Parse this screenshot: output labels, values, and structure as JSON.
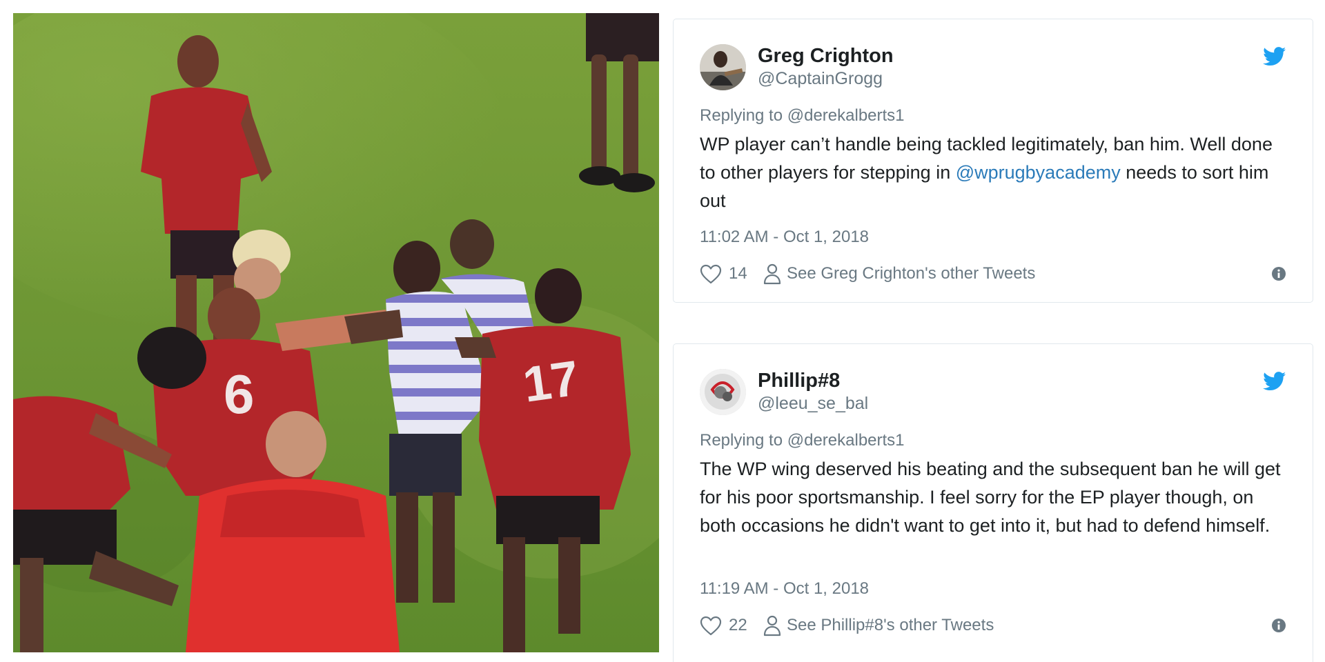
{
  "tweets": [
    {
      "name": "Greg Crighton",
      "handle": "@CaptainGrogg",
      "replying_prefix": "Replying to ",
      "replying_to": "@derekalberts1",
      "text_part1": "WP player can’t handle being tackled legitimately, ban him. Well done to other players for stepping in ",
      "mention": "@wprugbyacademy",
      "text_part2": " needs to sort him out",
      "timestamp": "11:02 AM - Oct 1, 2018",
      "likes": "14",
      "other_tweets_label": "See Greg Crighton's other Tweets"
    },
    {
      "name": "Phillip#8",
      "handle": "@leeu_se_bal",
      "replying_prefix": "Replying to ",
      "replying_to": "@derekalberts1",
      "text": "The WP wing deserved his beating and the subsequent ban he will get for his poor sportsmanship. I feel sorry for the EP player though, on both occasions he didn't want to get into it, but had to defend himself.",
      "timestamp": "11:19 AM - Oct 1, 2018",
      "likes": "22",
      "other_tweets_label": "See Phillip#8's other Tweets"
    }
  ],
  "icons": {
    "twitter": "twitter-bird-icon",
    "like": "heart-icon",
    "profile": "person-icon",
    "info": "info-icon"
  },
  "colors": {
    "twitter_blue": "#1da1f2",
    "link": "#2b7bb9",
    "secondary_text": "#697882",
    "primary_text": "#1c2022",
    "card_border": "#e1e8ed"
  }
}
